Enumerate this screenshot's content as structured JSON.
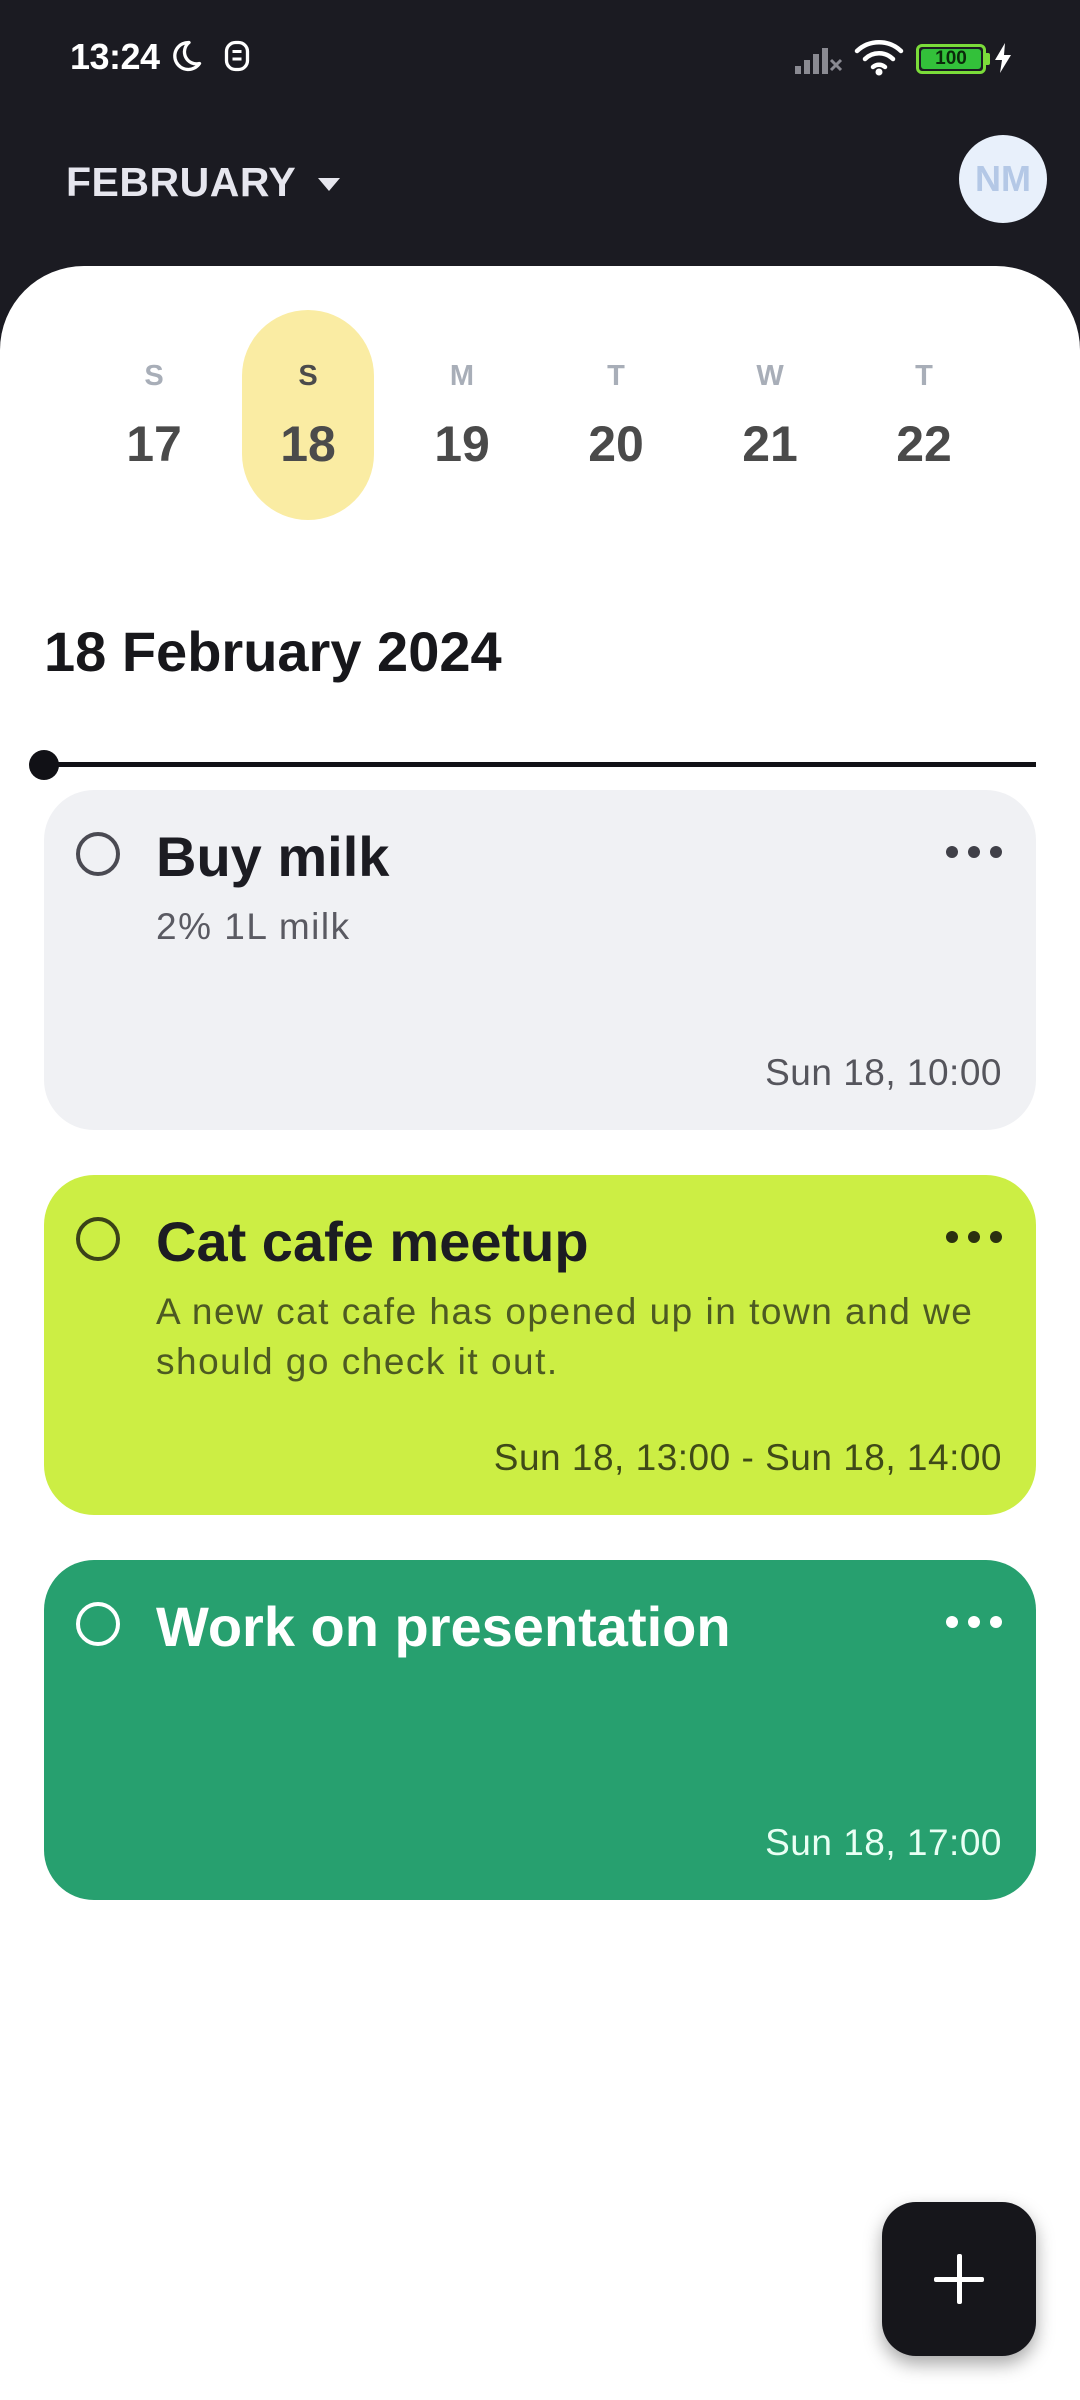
{
  "status_bar": {
    "time": "13:24",
    "battery": "100",
    "icons": [
      "moon-icon",
      "alarm-icon",
      "signal-icon",
      "wifi-icon",
      "battery-icon",
      "charging-icon"
    ]
  },
  "header": {
    "month": "FEBRUARY",
    "avatar_initials": "NM"
  },
  "week": {
    "days": [
      {
        "letter": "S",
        "number": "17",
        "selected": false
      },
      {
        "letter": "S",
        "number": "18",
        "selected": true
      },
      {
        "letter": "M",
        "number": "19",
        "selected": false
      },
      {
        "letter": "T",
        "number": "20",
        "selected": false
      },
      {
        "letter": "W",
        "number": "21",
        "selected": false
      },
      {
        "letter": "T",
        "number": "22",
        "selected": false
      }
    ]
  },
  "main": {
    "date_heading": "18 February 2024"
  },
  "tasks": [
    {
      "title": "Buy milk",
      "description": "2% 1L milk",
      "time": "Sun 18, 10:00",
      "color": "#f0f1f4"
    },
    {
      "title": "Cat cafe meetup",
      "description": "A new cat cafe has opened up in town and we should go check it out.",
      "time": "Sun 18, 13:00 - Sun 18, 14:00",
      "color": "#ccee44"
    },
    {
      "title": "Work on presentation",
      "description": "",
      "time": "Sun 18, 17:00",
      "color": "#27a06f"
    }
  ],
  "colors": {
    "header_bg": "#1b1b22",
    "selected_day": "#faeca3",
    "fab_bg": "#16161b"
  },
  "fab": {
    "icon": "plus-icon"
  }
}
